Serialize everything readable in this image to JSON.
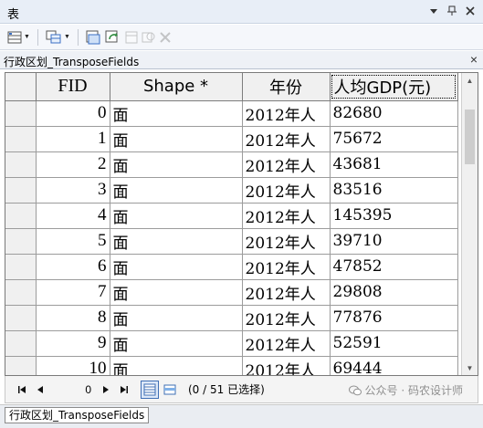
{
  "window": {
    "title": "表"
  },
  "table_tab": {
    "name": "行政区划_TransposeFields"
  },
  "grid": {
    "columns": [
      "FID",
      "Shape *",
      "年份",
      "人均GDP(元)"
    ],
    "rows": [
      {
        "fid": "0",
        "shape": "面",
        "year": "2012年人",
        "gdp": "82680"
      },
      {
        "fid": "1",
        "shape": "面",
        "year": "2012年人",
        "gdp": "75672"
      },
      {
        "fid": "2",
        "shape": "面",
        "year": "2012年人",
        "gdp": "43681"
      },
      {
        "fid": "3",
        "shape": "面",
        "year": "2012年人",
        "gdp": "83516"
      },
      {
        "fid": "4",
        "shape": "面",
        "year": "2012年人",
        "gdp": "145395"
      },
      {
        "fid": "5",
        "shape": "面",
        "year": "2012年人",
        "gdp": "39710"
      },
      {
        "fid": "6",
        "shape": "面",
        "year": "2012年人",
        "gdp": "47852"
      },
      {
        "fid": "7",
        "shape": "面",
        "year": "2012年人",
        "gdp": "29808"
      },
      {
        "fid": "8",
        "shape": "面",
        "year": "2012年人",
        "gdp": "77876"
      },
      {
        "fid": "9",
        "shape": "面",
        "year": "2012年人",
        "gdp": "52591"
      },
      {
        "fid": "10",
        "shape": "面",
        "year": "2012年人",
        "gdp": "69444"
      }
    ]
  },
  "navigator": {
    "current_record": "0",
    "selection_count": "(0 / 51 已选择)"
  },
  "watermark": {
    "text": "公众号 · 码农设计师"
  },
  "bottom_tab": {
    "name": "行政区划_TransposeFields"
  }
}
